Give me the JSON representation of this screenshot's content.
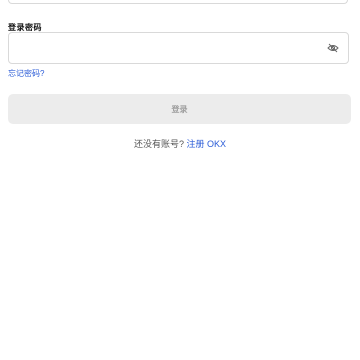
{
  "login_form": {
    "password_label": "登录密码",
    "password_value": "",
    "password_placeholder": "",
    "password_visibility_icon": "eye-slash-icon",
    "forgot_password_link": "忘记密码?",
    "submit_label": "登录",
    "no_account_text": "还没有账号?",
    "signup_link": "注册 OKX"
  },
  "colors": {
    "link": "#2a5bd7",
    "button_disabled_bg": "#ececec",
    "button_disabled_text": "#9e9e9e",
    "border": "#d9d9d9"
  }
}
